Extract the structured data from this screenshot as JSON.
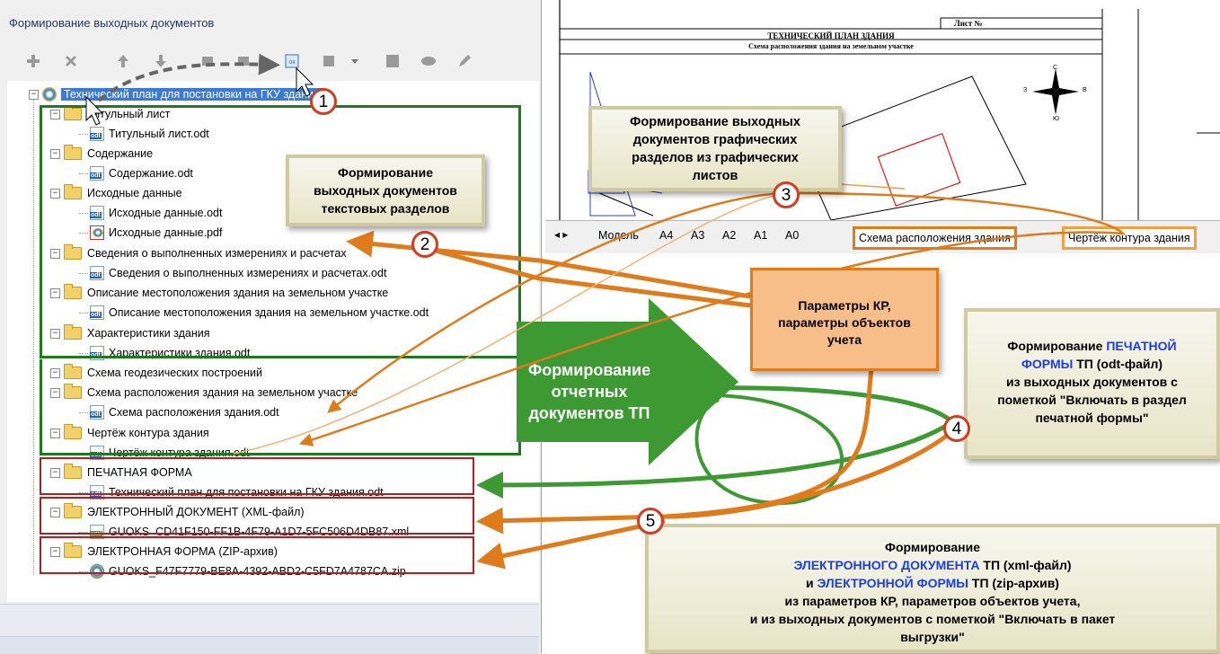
{
  "window": {
    "title": "Формирование выходных документов"
  },
  "toolbar": {
    "buttons": [
      "add-icon",
      "delete-icon",
      "move-up-icon",
      "move-down-icon",
      "indent-left-icon",
      "indent-right-icon",
      "generate-icon",
      "export-icon",
      "dropdown-icon",
      "stop-icon",
      "link-icon",
      "edit-icon"
    ]
  },
  "tree": {
    "root": "Технический план для постановки на ГКУ здания",
    "items": [
      {
        "type": "folder",
        "label": "Титульный лист"
      },
      {
        "type": "odt",
        "label": "Титульный лист.odt"
      },
      {
        "type": "folder",
        "label": "Содержание"
      },
      {
        "type": "odt",
        "label": "Содержание.odt"
      },
      {
        "type": "folder",
        "label": "Исходные данные"
      },
      {
        "type": "odt",
        "label": "Исходные данные.odt"
      },
      {
        "type": "pdf",
        "label": "Исходные данные.pdf"
      },
      {
        "type": "folder",
        "label": "Сведения о выполненных измерениях и расчетах"
      },
      {
        "type": "odt",
        "label": "Сведения о выполненных измерениях и расчетах.odt"
      },
      {
        "type": "folder",
        "label": "Описание местоположения здания на земельном участке"
      },
      {
        "type": "odt",
        "label": "Описание местоположения здания на земельном участке.odt"
      },
      {
        "type": "folder",
        "label": "Характеристики здания"
      },
      {
        "type": "odt",
        "label": "Характеристики здания.odt"
      },
      {
        "type": "folder",
        "label": "Схема геодезических построений"
      },
      {
        "type": "folder",
        "label": "Схема расположения здания на земельном участке"
      },
      {
        "type": "odt",
        "label": "Схема расположения здания.odt"
      },
      {
        "type": "folder",
        "label": "Чертёж контура здания"
      },
      {
        "type": "odt",
        "label": "Чертёж контура здания.odt"
      },
      {
        "type": "folder",
        "label": "ПЕЧАТНАЯ ФОРМА"
      },
      {
        "type": "odt",
        "label": "Технический план для постановки на ГКУ здания.odt"
      },
      {
        "type": "folder",
        "label": "ЭЛЕКТРОННЫЙ ДОКУМЕНТ (XML-файл)"
      },
      {
        "type": "xml",
        "label": "GUOKS_CD41F150-FF1B-4F79-A1D7-5FC506D4DB87.xml"
      },
      {
        "type": "folder",
        "label": "ЭЛЕКТРОННАЯ ФОРМА (ZIP-архив)"
      },
      {
        "type": "zip",
        "label": "GUOKS_F47F7779-BE8A-4392-ABD2-C5FD7A4787CA.zip"
      }
    ]
  },
  "drawing": {
    "sheet_label": "Лист №",
    "title": "ТЕХНИЧЕСКИЙ ПЛАН ЗДАНИЯ",
    "subtitle": "Схема расположения здания на земельном участке",
    "compass": {
      "n": "С",
      "s": "Ю",
      "w": "З",
      "e": "В"
    },
    "tabs": [
      "Модель",
      "А4",
      "А3",
      "А2",
      "А1",
      "А0",
      "Схема расположения здания",
      "Чертёж контура здания"
    ]
  },
  "callouts": {
    "text_sections": [
      "Формирование",
      "выходных документов",
      "текстовых разделов"
    ],
    "graphic_sections": [
      "Формирование выходных",
      "документов графических",
      "разделов из графических",
      "листов"
    ],
    "kr_params": [
      "Параметры КР,",
      "параметры объектов",
      "учета"
    ],
    "green_arrow": [
      "Формирование",
      "отчетных",
      "документов ТП"
    ],
    "print_form": {
      "l1a": "Формирование ",
      "l1b": "ПЕЧАТНОЙ",
      "l2a": "ФОРМЫ",
      "l2b": " ТП (odt-файл)",
      "l3": "из выходных документов с",
      "l4": "пометкой \"Включать в раздел",
      "l5": "печатной формы\""
    },
    "electronic": {
      "l1": "Формирование",
      "l2a": "ЭЛЕКТРОННОГО ДОКУМЕНТА",
      "l2b": " ТП (xml-файл)",
      "l3a": "и ",
      "l3b": "ЭЛЕКТРОННОЙ ФОРМЫ",
      "l3c": " ТП (zip-архив)",
      "l4": "из параметров КР, параметров объектов учета,",
      "l5": "и из выходных документов с пометкой \"Включать в пакет",
      "l6": "выгрузки\""
    }
  },
  "markers": [
    "1",
    "2",
    "3",
    "4",
    "5"
  ],
  "colors": {
    "green": "#3d9a32",
    "orange": "#e07b1b",
    "red": "#c82020",
    "blue": "#1a3fe0",
    "dark_green": "#1f7a1f"
  }
}
